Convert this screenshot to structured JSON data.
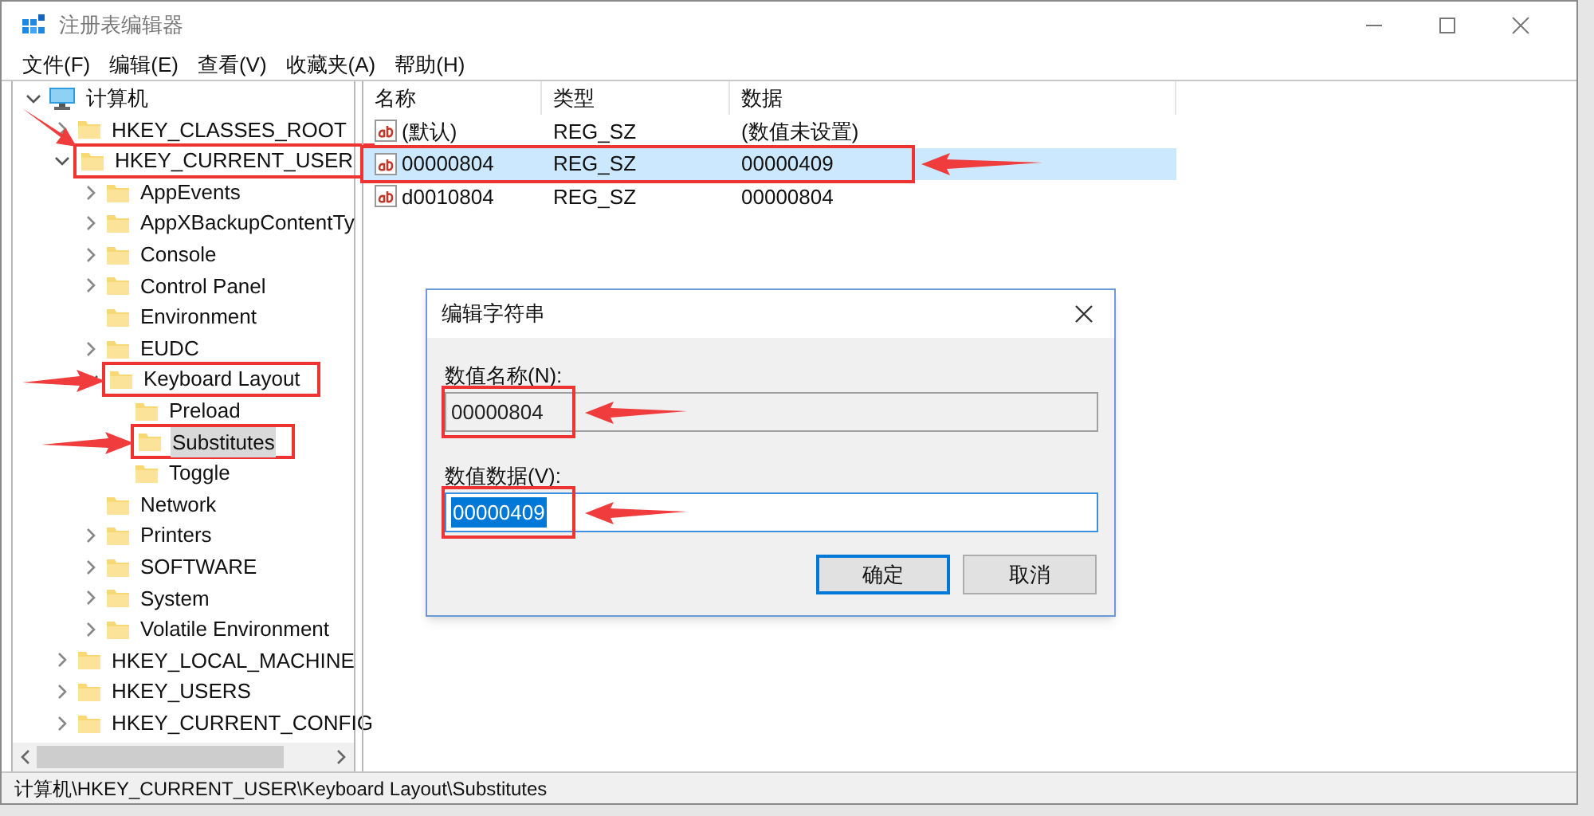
{
  "window": {
    "title": "注册表编辑器"
  },
  "menu": [
    "文件(F)",
    "编辑(E)",
    "查看(V)",
    "收藏夹(A)",
    "帮助(H)"
  ],
  "tree": [
    {
      "label": "计算机",
      "kind": "computer",
      "expanded": true,
      "selected": false,
      "marked": false,
      "children": [
        {
          "label": "HKEY_CLASSES_ROOT",
          "kind": "folder",
          "expandable": true,
          "expanded": false,
          "selected": false,
          "marked": false
        },
        {
          "label": "HKEY_CURRENT_USER",
          "kind": "folder",
          "expanded": true,
          "selected": false,
          "marked": true,
          "children": [
            {
              "label": "AppEvents",
              "kind": "folder",
              "expandable": true,
              "expanded": false,
              "selected": false,
              "marked": false
            },
            {
              "label": "AppXBackupContentTy",
              "kind": "folder",
              "expandable": true,
              "expanded": false,
              "selected": false,
              "marked": false
            },
            {
              "label": "Console",
              "kind": "folder",
              "expandable": true,
              "expanded": false,
              "selected": false,
              "marked": false
            },
            {
              "label": "Control Panel",
              "kind": "folder",
              "expandable": true,
              "expanded": false,
              "selected": false,
              "marked": false
            },
            {
              "label": "Environment",
              "kind": "folder",
              "expandable": false,
              "expanded": false,
              "selected": false,
              "marked": false
            },
            {
              "label": "EUDC",
              "kind": "folder",
              "expandable": true,
              "expanded": false,
              "selected": false,
              "marked": false
            },
            {
              "label": "Keyboard Layout",
              "kind": "folder",
              "expanded": true,
              "selected": false,
              "marked": true,
              "children": [
                {
                  "label": "Preload",
                  "kind": "folder",
                  "expandable": false,
                  "expanded": false,
                  "selected": false,
                  "marked": false
                },
                {
                  "label": "Substitutes",
                  "kind": "folder",
                  "expandable": false,
                  "expanded": false,
                  "selected": true,
                  "marked": true
                },
                {
                  "label": "Toggle",
                  "kind": "folder",
                  "expandable": false,
                  "expanded": false,
                  "selected": false,
                  "marked": false
                }
              ]
            },
            {
              "label": "Network",
              "kind": "folder",
              "expandable": false,
              "expanded": false,
              "selected": false,
              "marked": false
            },
            {
              "label": "Printers",
              "kind": "folder",
              "expandable": true,
              "expanded": false,
              "selected": false,
              "marked": false
            },
            {
              "label": "SOFTWARE",
              "kind": "folder",
              "expandable": true,
              "expanded": false,
              "selected": false,
              "marked": false
            },
            {
              "label": "System",
              "kind": "folder",
              "expandable": true,
              "expanded": false,
              "selected": false,
              "marked": false
            },
            {
              "label": "Volatile Environment",
              "kind": "folder",
              "expandable": true,
              "expanded": false,
              "selected": false,
              "marked": false
            }
          ]
        },
        {
          "label": "HKEY_LOCAL_MACHINE",
          "kind": "folder",
          "expandable": true,
          "expanded": false,
          "selected": false,
          "marked": false
        },
        {
          "label": "HKEY_USERS",
          "kind": "folder",
          "expandable": true,
          "expanded": false,
          "selected": false,
          "marked": false
        },
        {
          "label": "HKEY_CURRENT_CONFIG",
          "kind": "folder",
          "expandable": true,
          "expanded": false,
          "selected": false,
          "marked": false
        }
      ]
    }
  ],
  "table": {
    "columns": [
      "名称",
      "类型",
      "数据"
    ],
    "rows": [
      {
        "cells": [
          "(默认)",
          "REG_SZ",
          "(数值未设置)"
        ],
        "selected": false,
        "marked": false
      },
      {
        "cells": [
          "00000804",
          "REG_SZ",
          "00000409"
        ],
        "selected": true,
        "marked": true
      },
      {
        "cells": [
          "d0010804",
          "REG_SZ",
          "00000804"
        ],
        "selected": false,
        "marked": false
      }
    ]
  },
  "dialog": {
    "title": "编辑字符串",
    "fields": [
      {
        "label": "数值名称(N):",
        "value": "00000804",
        "disabled": true,
        "marked": true
      },
      {
        "label": "数值数据(V):",
        "value": "00000409",
        "disabled": false,
        "marked": true
      }
    ],
    "buttons": [
      {
        "label": "确定",
        "default": true
      },
      {
        "label": "取消",
        "default": false
      }
    ]
  },
  "status_bar": "计算机\\HKEY_CURRENT_USER\\Keyboard Layout\\Substitutes"
}
